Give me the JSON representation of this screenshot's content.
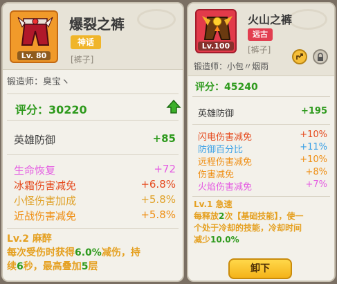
{
  "left": {
    "item_name": "爆裂之裤",
    "rarity": "神话",
    "level": "Lv. 80",
    "type": "[裤子]",
    "smith_label": "锻造师：",
    "smith_name": "臭宝ヽ",
    "score_label": "评分：",
    "score_value": "30220",
    "base_stat": {
      "label": "英雄防御",
      "value": "+85"
    },
    "stats": [
      {
        "label": "生命恢复",
        "value": "+72",
        "color": "#e45be2"
      },
      {
        "label": "冰霜伤害减免",
        "value": "+6.8%",
        "color": "#e54a1e"
      },
      {
        "label": "小怪伤害加成",
        "value": "+5.8%",
        "color": "#e0a22a"
      },
      {
        "label": "近战伤害减免",
        "value": "+5.8%",
        "color": "#ef8f15"
      }
    ],
    "skill_title": "Lv.2 麻醉",
    "skill_desc_line1_a": "每次受伤时获得",
    "skill_desc_line1_b": "6.0%",
    "skill_desc_line1_c": "减伤，持",
    "skill_desc_line2_a": "续",
    "skill_desc_line2_b": "6",
    "skill_desc_line2_c": "秒，最高叠加",
    "skill_desc_line2_d": "5",
    "skill_desc_line2_e": "层"
  },
  "right": {
    "item_name": "火山之裤",
    "rarity": "远古",
    "level": "Lv.100",
    "type": "[裤子]",
    "smith_label": "锻造师：",
    "smith_name": "小包〃烟雨",
    "score_label": "评分：",
    "score_value": "45240",
    "base_stat": {
      "label": "英雄防御",
      "value": "+195"
    },
    "stats": [
      {
        "label": "闪电伤害减免",
        "value": "+10%",
        "color": "#e54a1e"
      },
      {
        "label": "防御百分比",
        "value": "+11%",
        "color": "#3aa0e6"
      },
      {
        "label": "远程伤害减免",
        "value": "+10%",
        "color": "#ef8f15"
      },
      {
        "label": "伤害减免",
        "value": "+8%",
        "color": "#ef8f15"
      },
      {
        "label": "火焰伤害减免",
        "value": "+7%",
        "color": "#e45be2"
      }
    ],
    "skill_title": "Lv.1 急速",
    "skill_line1_a": "每释放",
    "skill_line1_b": "2",
    "skill_line1_c": "次【基础技能】，使一",
    "skill_line2": "个处于冷却的技能，冷却时间",
    "skill_line3_a": "减少",
    "skill_line3_b": "10.0%",
    "unequip_label": "卸下"
  },
  "icons": {
    "upgrade": "arrow-up-icon",
    "share": "share-icon",
    "lock": "lock-icon"
  }
}
